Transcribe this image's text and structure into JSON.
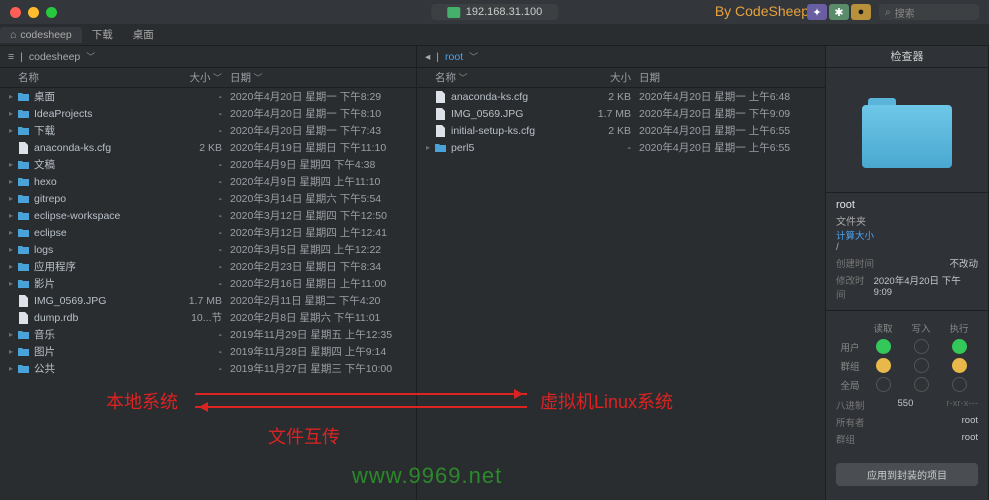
{
  "titlebar": {
    "address": "192.168.31.100",
    "brand": "By CodeSheep",
    "search_ph": "搜索"
  },
  "top_tabs": {
    "t0": "codesheep",
    "t1": "下载",
    "t2": "桌面"
  },
  "cols": {
    "name": "名称",
    "size": "大小",
    "date": "日期"
  },
  "local": {
    "path": "codesheep",
    "rows": [
      {
        "k": "folder",
        "n": "桌面",
        "s": "-",
        "d": "2020年4月20日 星期一 下午8:29"
      },
      {
        "k": "folder",
        "n": "IdeaProjects",
        "s": "-",
        "d": "2020年4月20日 星期一 下午8:10"
      },
      {
        "k": "folder",
        "n": "下载",
        "s": "-",
        "d": "2020年4月20日 星期一 下午7:43"
      },
      {
        "k": "file",
        "n": "anaconda-ks.cfg",
        "s": "2 KB",
        "d": "2020年4月19日 星期日 下午11:10"
      },
      {
        "k": "folder",
        "n": "文稿",
        "s": "-",
        "d": "2020年4月9日 星期四 下午4:38"
      },
      {
        "k": "folder",
        "n": "hexo",
        "s": "-",
        "d": "2020年4月9日 星期四 上午11:10"
      },
      {
        "k": "folder",
        "n": "gitrepo",
        "s": "-",
        "d": "2020年3月14日 星期六 下午5:54"
      },
      {
        "k": "folder",
        "n": "eclipse-workspace",
        "s": "-",
        "d": "2020年3月12日 星期四 下午12:50"
      },
      {
        "k": "folder",
        "n": "eclipse",
        "s": "-",
        "d": "2020年3月12日 星期四 上午12:41"
      },
      {
        "k": "folder",
        "n": "logs",
        "s": "-",
        "d": "2020年3月5日 星期四 上午12:22"
      },
      {
        "k": "folder",
        "n": "应用程序",
        "s": "-",
        "d": "2020年2月23日 星期日 下午8:34"
      },
      {
        "k": "folder",
        "n": "影片",
        "s": "-",
        "d": "2020年2月16日 星期日 上午11:00"
      },
      {
        "k": "file",
        "n": "IMG_0569.JPG",
        "s": "1.7 MB",
        "d": "2020年2月11日 星期二 下午4:20"
      },
      {
        "k": "file",
        "n": "dump.rdb",
        "s": "10...节",
        "d": "2020年2月8日 星期六 下午11:01"
      },
      {
        "k": "folder",
        "n": "音乐",
        "s": "-",
        "d": "2019年11月29日 星期五 上午12:35"
      },
      {
        "k": "folder",
        "n": "图片",
        "s": "-",
        "d": "2019年11月28日 星期四 上午9:14"
      },
      {
        "k": "folder",
        "n": "公共",
        "s": "-",
        "d": "2019年11月27日 星期三 下午10:00"
      }
    ]
  },
  "remote": {
    "path": "root",
    "rows": [
      {
        "k": "file",
        "n": "anaconda-ks.cfg",
        "s": "2 KB",
        "d": "2020年4月20日 星期一 上午6:48"
      },
      {
        "k": "file",
        "n": "IMG_0569.JPG",
        "s": "1.7 MB",
        "d": "2020年4月20日 星期一 下午9:09"
      },
      {
        "k": "file",
        "n": "initial-setup-ks.cfg",
        "s": "2 KB",
        "d": "2020年4月20日 星期一 上午6:55"
      },
      {
        "k": "folder",
        "n": "perl5",
        "s": "-",
        "d": "2020年4月20日 星期一 上午6:55"
      }
    ]
  },
  "inspector": {
    "head": "检查器",
    "name": "root",
    "kind": "文件夹",
    "sizelink": "计算大小",
    "path": "/",
    "created_l": "创建时间",
    "created_v": "不改动",
    "modified_l": "修改时间",
    "modified_v": "2020年4月20日 下午9:09",
    "perm": {
      "read": "读取",
      "write": "写入",
      "exec": "执行",
      "user": "用户",
      "group": "群组",
      "other": "全局"
    },
    "oct_l": "八进制",
    "oct_v": "550",
    "oct_note": "r-xr-x---",
    "owner_l": "所有者",
    "owner_v": "root",
    "grp_l": "群组",
    "grp_v": "root",
    "apply_btn": "应用到封装的项目"
  },
  "overlay": {
    "local_label": "本地系统",
    "remote_label": "虚拟机Linux系统",
    "transfer": "文件互传",
    "watermark": "www.9969.net"
  }
}
